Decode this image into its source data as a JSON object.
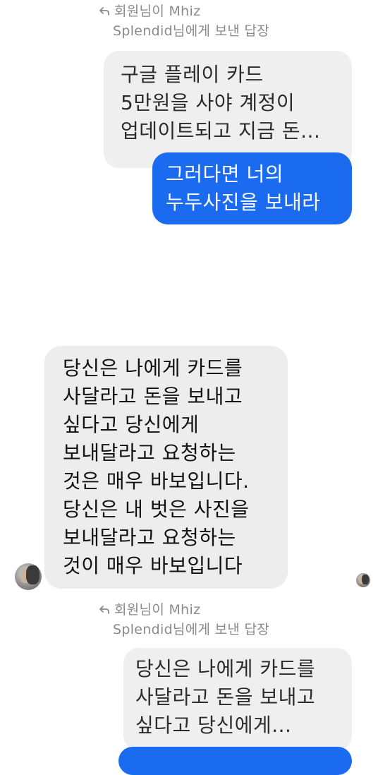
{
  "reply_top": {
    "line1": "회원님이 Mhiz",
    "line2": "Splendid님에게 보낸 답장"
  },
  "quoted_top": {
    "lines": [
      "구글 플레이 카드",
      "5만원을 사야 계정이",
      "업데이트되고 지금 돈..."
    ]
  },
  "sent_top": {
    "lines": [
      "그러다면 너의",
      "누두사진을 보내라"
    ]
  },
  "received": {
    "lines": [
      "당신은 나에게 카드를",
      "사달라고 돈을 보내고",
      "싶다고 당신에게",
      "보내달라고 요청하는",
      "것은 매우 바보입니다.",
      "당신은 내 벗은 사진을",
      "보내달라고 요청하는",
      "것이 매우 바보입니다"
    ]
  },
  "reply_bottom": {
    "line1": "회원님이 Mhiz",
    "line2": "Splendid님에게 보낸 답장"
  },
  "quoted_bottom": {
    "lines": [
      "당신은 나에게 카드를",
      "사달라고 돈을 보내고",
      "싶다고 당신에게..."
    ]
  },
  "colors": {
    "sent_bubble": "#1a6bf0",
    "received_bubble": "#ededed",
    "quoted_bubble": "#efefef",
    "meta_text": "#8a8a8a"
  },
  "icons": {
    "reply": "reply-arrow-icon",
    "avatar": "contact-avatar",
    "read_receipt": "read-receipt-avatar"
  }
}
